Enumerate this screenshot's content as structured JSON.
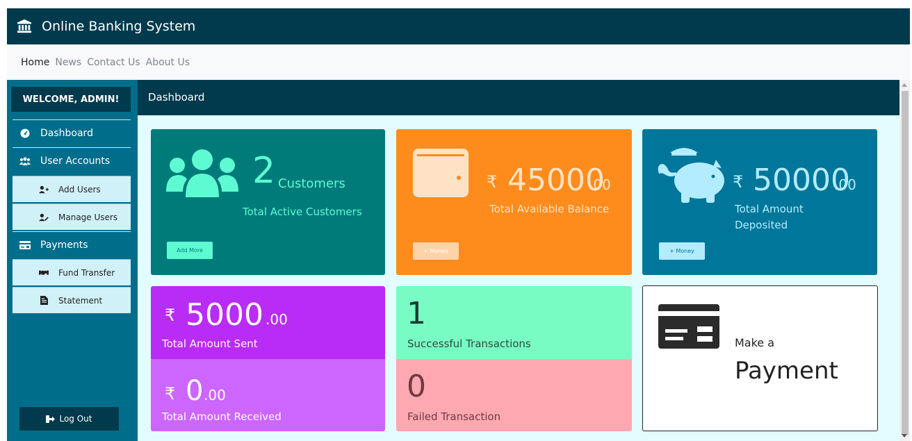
{
  "header": {
    "title": "Online Banking System",
    "icon": "bank-icon"
  },
  "nav": {
    "links": [
      "Home",
      "News",
      "Contact Us",
      "About Us"
    ],
    "active": "Home"
  },
  "sidebar": {
    "welcome": "WELCOME, ADMIN!",
    "items": [
      {
        "label": "Dashboard",
        "icon": "dashboard-icon"
      },
      {
        "label": "User Accounts",
        "icon": "users-icon"
      },
      {
        "label": "Add Users",
        "icon": "user-plus-icon"
      },
      {
        "label": "Manage Users",
        "icon": "user-edit-icon"
      },
      {
        "label": "Payments",
        "icon": "card-icon"
      },
      {
        "label": "Fund Transfer",
        "icon": "handshake-icon"
      },
      {
        "label": "Statement",
        "icon": "document-icon"
      }
    ],
    "logout": "Log Out"
  },
  "main": {
    "title": "Dashboard"
  },
  "cards": {
    "customers": {
      "count": "2",
      "unit": "Customers",
      "label": "Total Active Customers",
      "button": "Add More"
    },
    "balance": {
      "currency": "₹",
      "whole": "45000",
      "decimal": ".00",
      "label": "Total Available Balance",
      "button": "+ Money"
    },
    "deposited": {
      "currency": "₹",
      "whole": "50000",
      "decimal": ".00",
      "label_line1": "Total Amount",
      "label_line2": "Deposited",
      "button": "+ Money"
    },
    "sent": {
      "currency": "₹",
      "whole": "5000",
      "decimal": ".00",
      "label": "Total Amount Sent"
    },
    "received": {
      "currency": "₹",
      "whole": "0",
      "decimal": ".00",
      "label": "Total Amount Received"
    },
    "successful": {
      "count": "1",
      "label": "Successful Transactions"
    },
    "failed": {
      "count": "0",
      "label": "Failed Transaction"
    },
    "payment": {
      "line1": "Make a",
      "line2": "Payment"
    }
  },
  "colors": {
    "primary_dark": "#003a4c",
    "sidebar": "#006e8a",
    "customers_card": "#007b7a",
    "balance_card": "#fd8c1c",
    "deposited_card": "#00779a",
    "sent_card": "#b92cf5",
    "received_card": "#cc66ff",
    "success_card": "#79fcc3",
    "failed_card": "#ffa8b1"
  }
}
